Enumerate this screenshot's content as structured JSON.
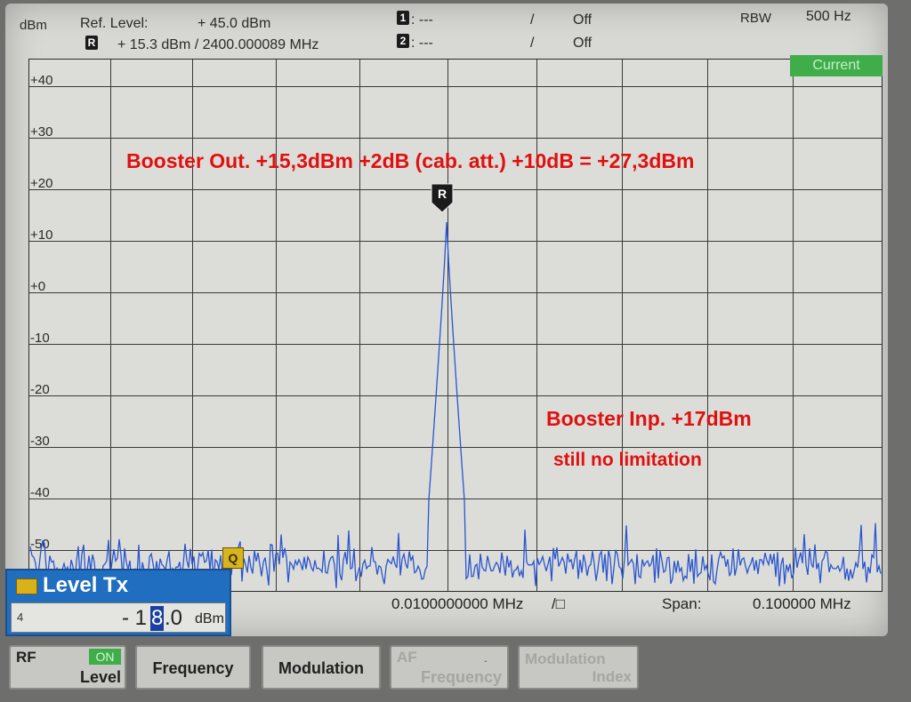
{
  "header": {
    "unit": "dBm",
    "ref_level_label": "Ref. Level:",
    "ref_level_value": "+ 45.0  dBm",
    "ref_marker_icon": "R",
    "ref_marker_value": "+ 15.3  dBm  /   2400.000089   MHz",
    "marker1_icon": "1",
    "marker1_value": ":        ---",
    "marker1_sep": "/",
    "marker1_state": "Off",
    "marker2_icon": "2",
    "marker2_value": ":        ---",
    "marker2_sep": "/",
    "marker2_state": "Off",
    "rbw_label": "RBW",
    "rbw_value": "500 Hz"
  },
  "plot": {
    "current_label": "Current",
    "y_labels": [
      "+40",
      "+30",
      "+20",
      "+10",
      "+0",
      "-10",
      "-20",
      "-30",
      "-40",
      "-50"
    ],
    "marker_label": "R",
    "trigger_icon": "Q",
    "annotations": {
      "booster_out": "Booster Out. +15,3dBm +2dB (cab. att.) +10dB = +27,3dBm",
      "booster_inp": "Booster Inp. +17dBm",
      "still_no_limit": "still no limitation"
    }
  },
  "bottom": {
    "center_freq": "0.0100000000 MHz",
    "center_suffix": "/□",
    "span_label": "Span:",
    "span_value": "0.100000  MHz"
  },
  "level_tx": {
    "title": "Level Tx",
    "field_prefix": "4",
    "value_before": "- 1",
    "value_cursor": "8",
    "value_after": ".0",
    "unit": "dBm"
  },
  "softkeys": {
    "rf_label": "RF",
    "rf_on": "ON",
    "rf_level": "Level",
    "frequency": "Frequency",
    "modulation": "Modulation",
    "af_label": "AF",
    "af_frequency": "Frequency",
    "af_dot": ".",
    "mod_index_1": "Modulation",
    "mod_index_2": "Index"
  },
  "colors": {
    "trace": "#2a55d0",
    "annotation": "#e01010",
    "current_badge": "#3fae4a",
    "level_box": "#1f6ec0"
  }
}
